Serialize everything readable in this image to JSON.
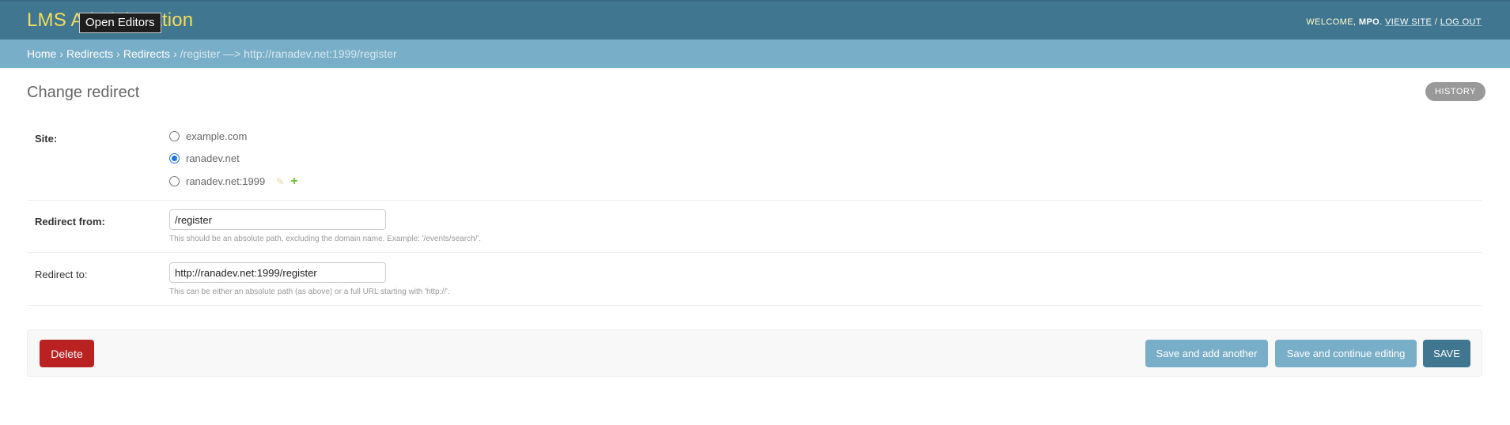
{
  "header": {
    "brand": "LMS Administration",
    "tooltip": "Open Editors",
    "welcome": "WELCOME,",
    "user": "MPO",
    "view_site": "VIEW SITE",
    "separator": "/",
    "log_out": "LOG OUT"
  },
  "breadcrumbs": {
    "items": [
      "Home",
      "Redirects",
      "Redirects"
    ],
    "current": "/register —> http://ranadev.net:1999/register"
  },
  "page": {
    "title": "Change redirect",
    "history": "HISTORY"
  },
  "form": {
    "site": {
      "label": "Site:",
      "options": [
        "example.com",
        "ranadev.net",
        "ranadev.net:1999"
      ],
      "selected": "ranadev.net"
    },
    "redirect_from": {
      "label": "Redirect from:",
      "value": "/register",
      "help": "This should be an absolute path, excluding the domain name. Example: '/events/search/'."
    },
    "redirect_to": {
      "label": "Redirect to:",
      "value": "http://ranadev.net:1999/register",
      "help": "This can be either an absolute path (as above) or a full URL starting with 'http://'."
    }
  },
  "actions": {
    "delete": "Delete",
    "save_add_another": "Save and add another",
    "save_continue": "Save and continue editing",
    "save": "SAVE"
  },
  "colors": {
    "header_bg": "#417690",
    "breadcrumb_bg": "#79aec8",
    "brand": "#f5dd5d",
    "delete": "#ba2121"
  },
  "icons": [
    "pencil-icon",
    "plus-icon"
  ]
}
